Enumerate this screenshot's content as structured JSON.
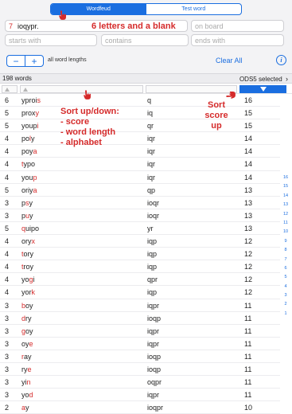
{
  "segmented": {
    "tab1": "Wordfeud",
    "tab2": "Test word"
  },
  "letters_field": {
    "count": "7",
    "value": "ioqypr."
  },
  "on_board_placeholder": "on board",
  "starts_with_placeholder": "starts with",
  "contains_placeholder": "contains",
  "ends_with_placeholder": "ends with",
  "stepper": {
    "minus": "−",
    "plus": "+"
  },
  "lengths_label": "all word lengths",
  "clear_label": "Clear All",
  "info_label": "i",
  "status": {
    "count": "198 words",
    "lexicon": "ODS5 selected"
  },
  "annotations": {
    "blank": "6 letters and a blank",
    "sort_title": "Sort up/down:",
    "sort_score": "- score",
    "sort_length": "- word length",
    "sort_alpha": "- alphabet",
    "sort_score_up_1": "Sort",
    "sort_score_up_2": "score",
    "sort_score_up_3": "up"
  },
  "rows": [
    {
      "len": "6",
      "pre": "yproi",
      "red": "s",
      "post": "",
      "letters": "q",
      "score": "16"
    },
    {
      "len": "5",
      "pre": "prox",
      "red": "y",
      "post": "",
      "letters": "iq",
      "score": "15"
    },
    {
      "len": "5",
      "pre": "youp",
      "red": "i",
      "post": "",
      "letters": "qr",
      "score": "15"
    },
    {
      "len": "4",
      "pre": "po",
      "red": "l",
      "post": "y",
      "letters": "iqr",
      "score": "14"
    },
    {
      "len": "4",
      "pre": "poy",
      "red": "a",
      "post": "",
      "letters": "iqr",
      "score": "14"
    },
    {
      "len": "4",
      "pre": "",
      "red": "t",
      "post": "ypo",
      "letters": "iqr",
      "score": "14"
    },
    {
      "len": "4",
      "pre": "you",
      "red": "p",
      "post": "",
      "letters": "iqr",
      "score": "14"
    },
    {
      "len": "5",
      "pre": "oriy",
      "red": "a",
      "post": "",
      "letters": "qp",
      "score": "13"
    },
    {
      "len": "3",
      "pre": "p",
      "red": "s",
      "post": "y",
      "letters": "ioqr",
      "score": "13"
    },
    {
      "len": "3",
      "pre": "p",
      "red": "u",
      "post": "y",
      "letters": "ioqr",
      "score": "13"
    },
    {
      "len": "5",
      "pre": "",
      "red": "q",
      "post": "uipo",
      "letters": "yr",
      "score": "13"
    },
    {
      "len": "4",
      "pre": "ory",
      "red": "x",
      "post": "",
      "letters": "iqp",
      "score": "12"
    },
    {
      "len": "4",
      "pre": "",
      "red": "t",
      "post": "ory",
      "letters": "iqp",
      "score": "12"
    },
    {
      "len": "4",
      "pre": "",
      "red": "t",
      "post": "roy",
      "letters": "iqp",
      "score": "12"
    },
    {
      "len": "4",
      "pre": "yo",
      "red": "g",
      "post": "i",
      "letters": "qpr",
      "score": "12"
    },
    {
      "len": "4",
      "pre": "yor",
      "red": "k",
      "post": "",
      "letters": "iqp",
      "score": "12"
    },
    {
      "len": "3",
      "pre": "",
      "red": "b",
      "post": "oy",
      "letters": "iqpr",
      "score": "11"
    },
    {
      "len": "3",
      "pre": "",
      "red": "d",
      "post": "ry",
      "letters": "ioqp",
      "score": "11"
    },
    {
      "len": "3",
      "pre": "",
      "red": "g",
      "post": "oy",
      "letters": "iqpr",
      "score": "11"
    },
    {
      "len": "3",
      "pre": "oy",
      "red": "e",
      "post": "",
      "letters": "iqpr",
      "score": "11"
    },
    {
      "len": "3",
      "pre": "",
      "red": "r",
      "post": "ay",
      "letters": "ioqp",
      "score": "11"
    },
    {
      "len": "3",
      "pre": "ry",
      "red": "e",
      "post": "",
      "letters": "ioqp",
      "score": "11"
    },
    {
      "len": "3",
      "pre": "yi",
      "red": "n",
      "post": "",
      "letters": "oqpr",
      "score": "11"
    },
    {
      "len": "3",
      "pre": "yo",
      "red": "d",
      "post": "",
      "letters": "iqpr",
      "score": "11"
    },
    {
      "len": "2",
      "pre": "",
      "red": "a",
      "post": "y",
      "letters": "ioqpr",
      "score": "10"
    }
  ],
  "score_index": [
    "16",
    "15",
    "14",
    "13",
    "12",
    "11",
    "10",
    "9",
    "8",
    "7",
    "6",
    "5",
    "4",
    "3",
    "2",
    "1"
  ],
  "colors": {
    "accent": "#1a6ee0",
    "annotation": "#d52b2b"
  },
  "icons": [
    "pointing-hand-icon",
    "sort-triangle-icon",
    "chevron-right-icon",
    "info-icon"
  ]
}
